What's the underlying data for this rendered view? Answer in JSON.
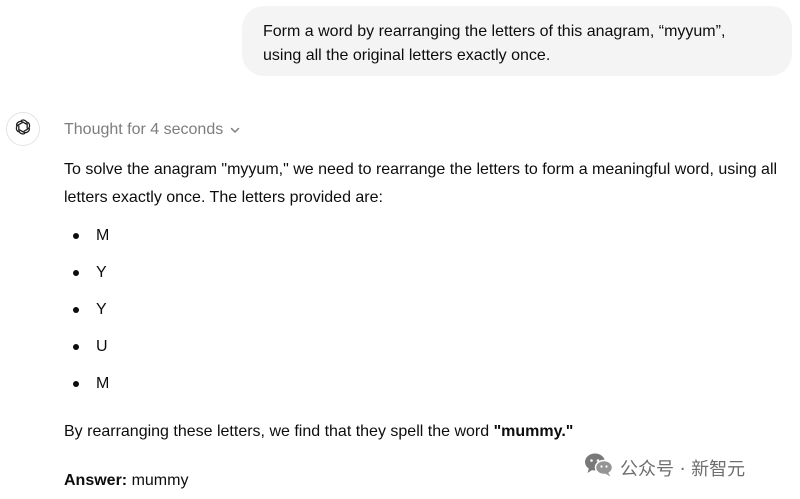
{
  "user_message": {
    "line1": "Form a word by rearranging the letters of this anagram, “myyum”,",
    "line2": "using all the original letters exactly once."
  },
  "assistant": {
    "avatar_icon": "openai-logo-icon",
    "thought_label": "Thought for 4 seconds",
    "thought_icon": "chevron-down-icon",
    "intro": "To solve the anagram \"myyum,\" we need to rearrange the letters to form a meaningful word, using all letters exactly once. The letters provided are:",
    "letters": [
      "M",
      "Y",
      "Y",
      "U",
      "M"
    ],
    "result_prefix": "By rearranging these letters, we find that they spell the word ",
    "result_word": "\"mummy.\"",
    "answer_label": "Answer:",
    "answer_value": " mummy"
  },
  "watermark": {
    "icon": "wechat-icon",
    "text": "公众号 · 新智元"
  }
}
